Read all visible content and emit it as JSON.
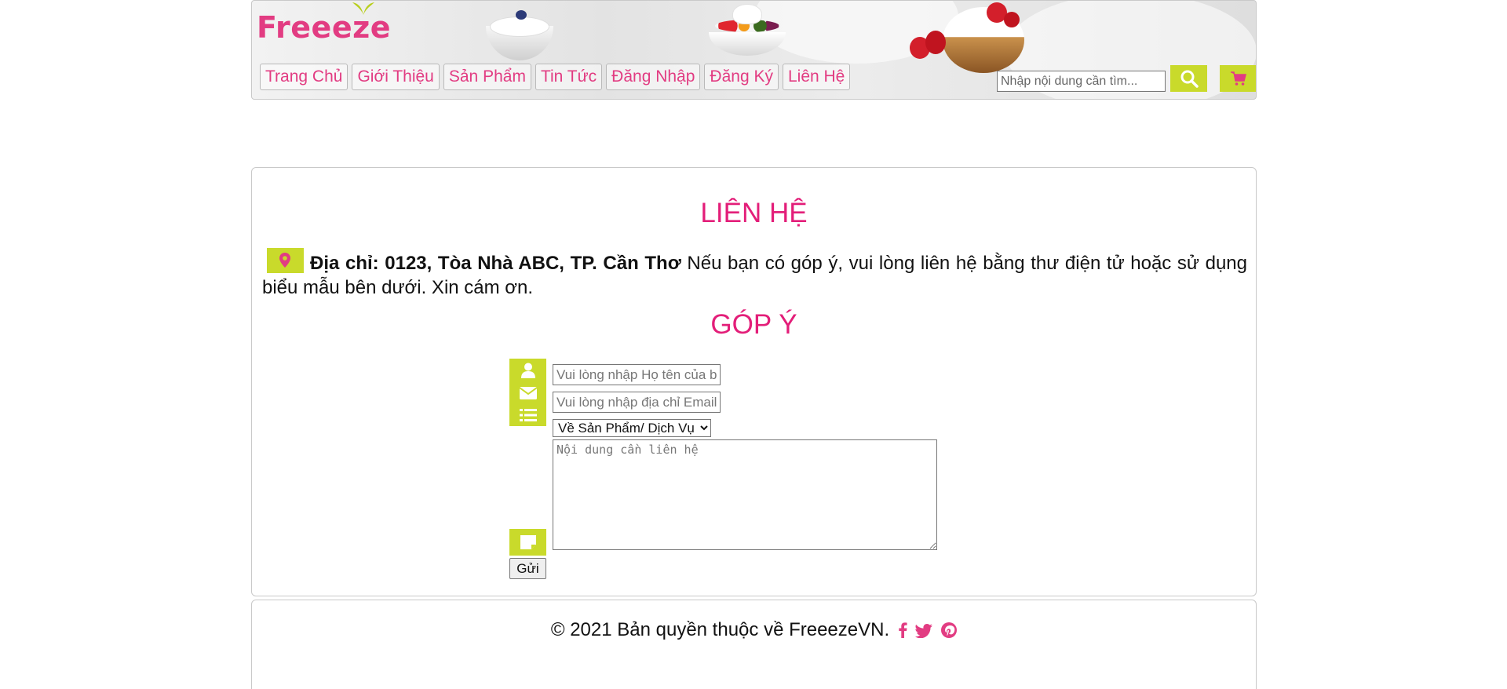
{
  "header": {
    "logo_text": "Freeeze",
    "nav": [
      {
        "label": "Trang Chủ"
      },
      {
        "label": "Giới Thiệu"
      },
      {
        "label": "Sản Phẩm"
      },
      {
        "label": "Tin Tức"
      },
      {
        "label": "Đăng Nhập"
      },
      {
        "label": "Đăng Ký"
      },
      {
        "label": "Liên Hệ"
      }
    ],
    "search_placeholder": "Nhập nội dung cần tìm...",
    "search_icon": "search-icon",
    "cart_icon": "cart-icon"
  },
  "contact": {
    "title": "LIÊN HỆ",
    "address_icon": "map-marker-icon",
    "address_label": "Địa chỉ: 0123, Tòa Nhà ABC, TP. Cần Thơ",
    "address_note": "Nếu bạn có góp ý, vui lòng liên hệ bằng thư điện tử hoặc sử dụng biểu mẫu bên dưới. Xin cám ơn."
  },
  "feedback": {
    "title": "GÓP Ý",
    "name_placeholder": "Vui lòng nhập Họ tên của bạn",
    "email_placeholder": "Vui lòng nhập địa chỉ Email",
    "topic_selected": "Về Sản Phẩm/ Dịch Vụ",
    "message_placeholder": "Nội dung cần liên hệ",
    "send_label": "Gửi",
    "icons": [
      "user-icon",
      "envelope-icon",
      "list-icon",
      "note-icon"
    ]
  },
  "footer": {
    "copyright": "© 2021 Bản quyền thuộc về FreeezeVN.",
    "social_icons": [
      "facebook-icon",
      "twitter-icon",
      "pinterest-icon"
    ]
  },
  "colors": {
    "accent_pink": "#e31e79",
    "accent_lime": "#c9da2b"
  }
}
